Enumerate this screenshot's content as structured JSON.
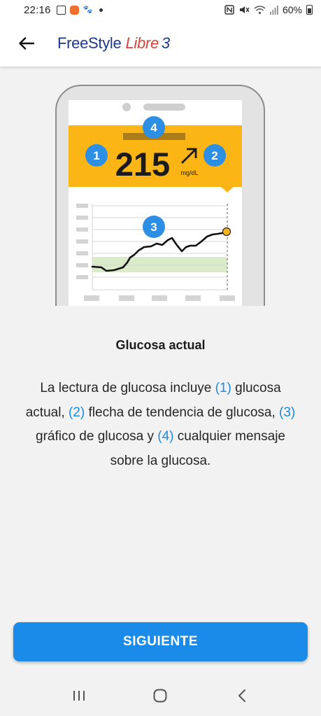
{
  "status_bar": {
    "time": "22:16",
    "battery": "60%",
    "icons": [
      "image-icon",
      "app-notification-icon",
      "paw-icon",
      "dot-icon",
      "nfc-icon",
      "mute-icon",
      "wifi-icon",
      "signal-icon",
      "battery-icon"
    ]
  },
  "header": {
    "back_icon": "arrow-left-icon",
    "brand_part1": "FreeStyle",
    "brand_part2": "Libre",
    "brand_part3": "3"
  },
  "illustration": {
    "glucose_value": "215",
    "unit": "mg/dL",
    "markers": [
      "1",
      "2",
      "3",
      "4"
    ],
    "colors": {
      "reading_banner": "#fbb515",
      "marker": "#2c8fe4",
      "target_band": "#d9ebc8",
      "current_point": "#f7b522"
    }
  },
  "content": {
    "title": "Glucosa actual",
    "desc": {
      "t1": "La lectura de glucosa incluye ",
      "r1": "(1)",
      "t2": " glucosa actual, ",
      "r2": "(2)",
      "t3": " flecha de tendencia de glucosa, ",
      "r3": "(3)",
      "t4": " gráfico de glucosa y ",
      "r4": "(4)",
      "t5": " cualquier mensaje sobre la glucosa."
    }
  },
  "actions": {
    "next_label": "SIGUIENTE",
    "accent": "#1a8be8"
  },
  "system_nav": {
    "icons": [
      "recent-apps-icon",
      "home-icon",
      "back-icon"
    ]
  }
}
